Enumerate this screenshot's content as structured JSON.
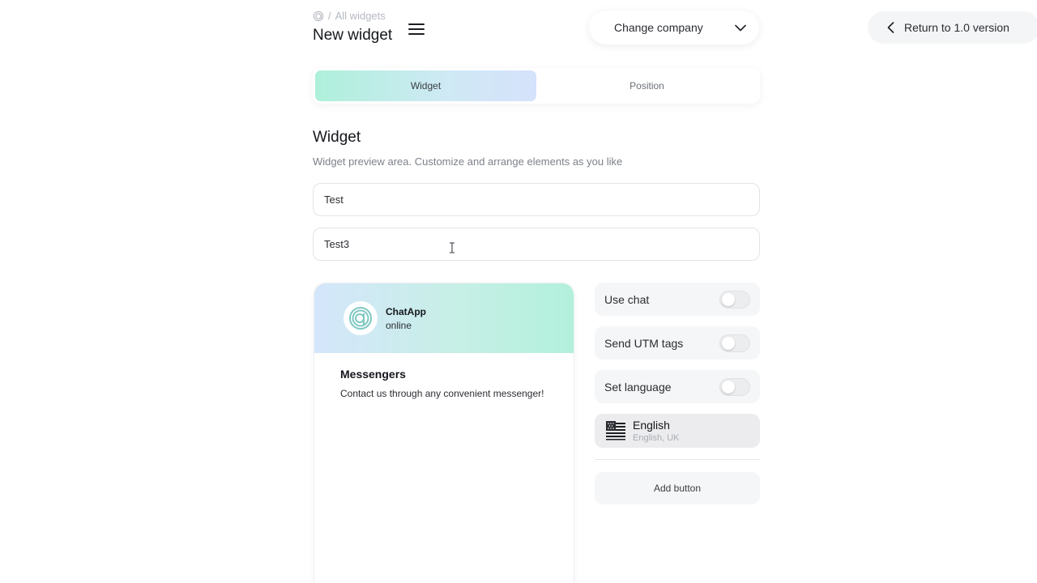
{
  "breadcrumb": {
    "separator": "/",
    "link": "All widgets"
  },
  "page_title": "New widget",
  "header": {
    "company_select_label": "Change company",
    "return_button_label": "Return to 1.0 version"
  },
  "tabs": [
    {
      "label": "Widget",
      "active": true
    },
    {
      "label": "Position",
      "active": false
    }
  ],
  "section": {
    "title": "Widget",
    "subtitle": "Widget preview area. Customize and arrange elements as you like"
  },
  "fields": [
    {
      "value": "Test"
    },
    {
      "value": "Test3"
    }
  ],
  "preview": {
    "app_name": "ChatApp",
    "status": "online",
    "heading": "Messengers",
    "description": "Contact us through any convenient messenger!"
  },
  "settings": {
    "toggles": [
      {
        "label": "Use chat",
        "on": false
      },
      {
        "label": "Send UTM tags",
        "on": false
      },
      {
        "label": "Set language",
        "on": false
      }
    ],
    "language": {
      "name": "English",
      "sub": "English, UK",
      "flag_icon": "us-flag-icon"
    },
    "add_button_label": "Add button"
  },
  "colors": {
    "tab_active_start": "#aef0da",
    "tab_active_end": "#d5e2fb",
    "logo_teal": "#7cc8c1"
  }
}
